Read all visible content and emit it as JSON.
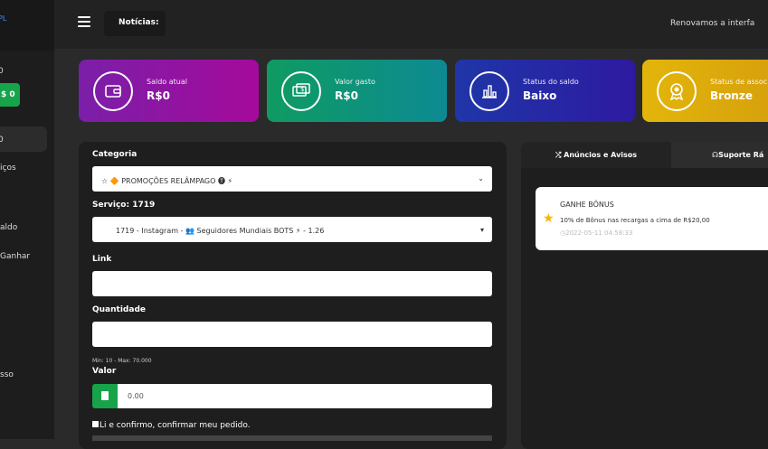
{
  "sidebar": {
    "logo_text": "PL",
    "items": [
      {
        "label": "0"
      },
      {
        "label": "0"
      },
      {
        "label": "0"
      },
      {
        "label": "iços"
      },
      {
        "label": "aldo"
      },
      {
        "label": "Ganhar"
      },
      {
        "label": "sso"
      }
    ],
    "balance_badge": "$ 0"
  },
  "header": {
    "news_label": "Notícias:",
    "marquee": "Renovamos a interfa"
  },
  "cards": [
    {
      "label": "Saldo atual",
      "value": "R$0",
      "icon": "wallet-icon"
    },
    {
      "label": "Valor gasto",
      "value": "R$0",
      "icon": "money-icon"
    },
    {
      "label": "Status do saldo",
      "value": "Baixo",
      "icon": "chart-icon"
    },
    {
      "label": "Status de assoc",
      "value": "Bronze",
      "icon": "medal-icon"
    }
  ],
  "form": {
    "categoria_label": "Categoria",
    "categoria_value": "☆ 🔶 PROMOÇÕES RELÂMPAGO 🅣 ⚡",
    "servico_label": "Serviço: 1719",
    "servico_value": "1719 - Instagram - 👥 Seguidores Mundiais BOTS ⚡ - 1.26",
    "link_label": "Link",
    "link_value": "",
    "quantidade_label": "Quantidade",
    "quantidade_value": "",
    "quantidade_hint": "Min: 10 - Max: 70.000",
    "valor_label": "Valor",
    "valor_value": "0.00",
    "confirm_text": "Li e confirmo, confirmar meu pedido."
  },
  "news": {
    "tabs": [
      {
        "label": "Anúncios e Avisos",
        "icon": "shuffle-icon"
      },
      {
        "label": "Suporte Rá",
        "icon": "support-icon"
      }
    ],
    "announcements": [
      {
        "title": "GANHE BÔNUS",
        "text": "10% de Bônus nas recargas a cima de R$20,00",
        "date": "2022-05-11 04:58:33",
        "icon": "star-icon"
      }
    ]
  }
}
